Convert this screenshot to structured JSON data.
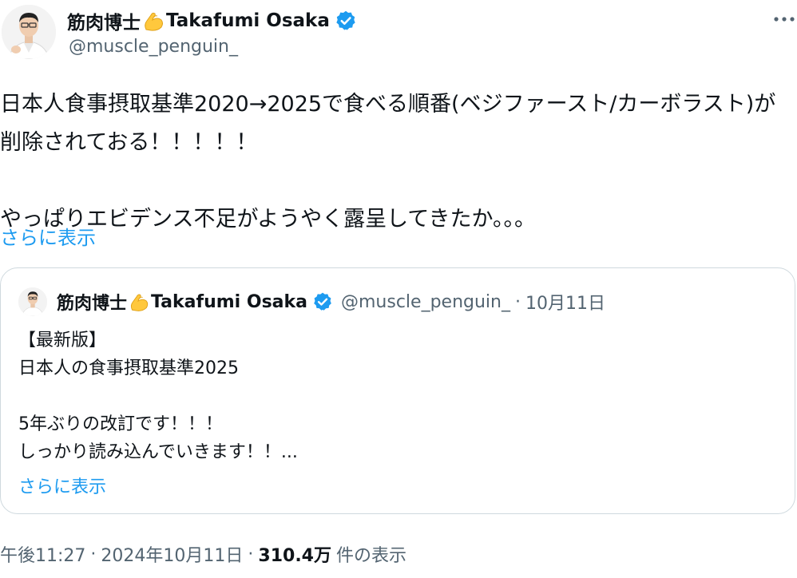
{
  "author": {
    "name_prefix": "筋肉博士",
    "name_suffix": "Takafumi Osaka",
    "handle": "@muscle_penguin_",
    "flex_emoji_icon": "flexed-biceps-icon",
    "verified_icon": "verified-badge-icon"
  },
  "post": {
    "text": "日本人食事摂取基準2020→2025で食べる順番(ベジファースト/カーボラスト)が削除されておる！！！！！\n\nやっぱりエビデンス不足がようやく露呈してきたか。。。",
    "show_more": "さらに表示"
  },
  "quote": {
    "name_prefix": "筋肉博士",
    "name_suffix": "Takafumi Osaka",
    "handle": "@muscle_penguin_",
    "dot": "·",
    "date": "10月11日",
    "text": "【最新版】\n日本人の食事摂取基準2025\n\n5年ぶりの改訂です！！！\nしっかり読み込んでいきます！！...",
    "show_more": "さらに表示"
  },
  "footer": {
    "time": "午後11:27",
    "sep1": "·",
    "date": "2024年10月11日",
    "sep2": "·",
    "views_count": "310.4万",
    "views_label": "件の表示"
  },
  "colors": {
    "accent": "#1d9bf0",
    "text": "#0f1419",
    "muted": "#536471",
    "border": "#cfd9de"
  },
  "icons": {
    "more": "more-horizontal-icon"
  }
}
